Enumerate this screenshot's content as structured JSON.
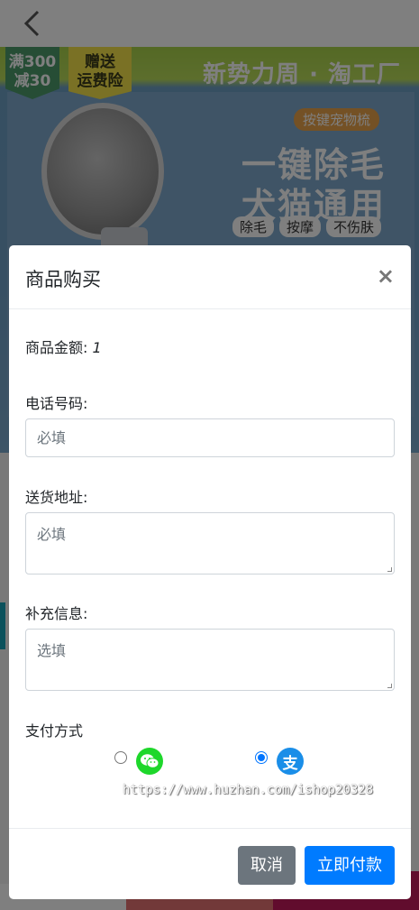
{
  "banner": {
    "promo_a": "满300\n减30",
    "promo_a_line1": "满300",
    "promo_a_line2": "减30",
    "promo_b_line1": "赠送",
    "promo_b_line2": "运费险",
    "brand": "新势力周 · 淘工厂",
    "tagline": "按键宠物梳",
    "headline1": "一键除毛",
    "headline2": "犬猫通用",
    "chips": [
      "除毛",
      "按摩",
      "不伤肤"
    ]
  },
  "modal": {
    "title": "商品购买",
    "close_glyph": "×",
    "amount_label": "商品金额:",
    "amount_value": "1",
    "phone_label": "电话号码:",
    "phone_placeholder": "必填",
    "address_label": "送货地址:",
    "address_placeholder": "必填",
    "extra_label": "补充信息:",
    "extra_placeholder": "选填",
    "payment_label": "支付方式",
    "payment_options": [
      {
        "name": "wechat",
        "icon": "wechat-icon",
        "selected": false,
        "color": "#1ed72b"
      },
      {
        "name": "alipay",
        "icon": "alipay-icon",
        "glyph": "支",
        "selected": true,
        "color": "#1a8ee8"
      }
    ],
    "watermark": "https://www.huzhan.com/ishop20328",
    "cancel_label": "取消",
    "pay_label": "立即付款"
  },
  "colors": {
    "primary": "#007bff",
    "secondary": "#6c757d"
  }
}
